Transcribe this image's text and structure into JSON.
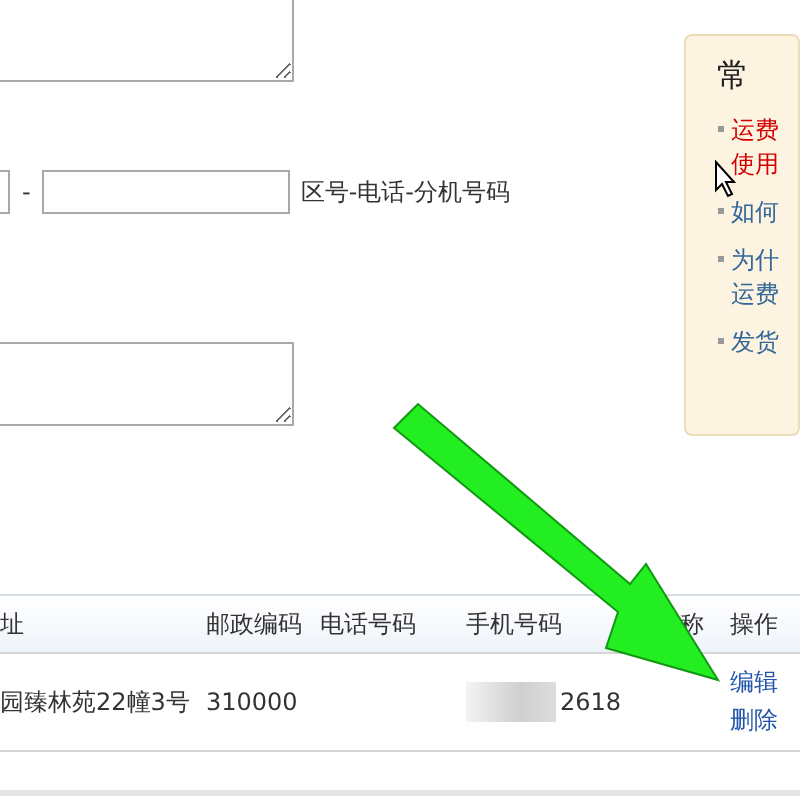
{
  "form": {
    "phone_separator": "-",
    "phone_hint": "区号-电话-分机号码"
  },
  "help_panel": {
    "title": "常",
    "items": [
      {
        "text": "运费使用",
        "kind": "highlight"
      },
      {
        "text": "如何",
        "kind": "normal"
      },
      {
        "text": "为什运费",
        "kind": "normal"
      },
      {
        "text": "发货",
        "kind": "normal"
      }
    ]
  },
  "table": {
    "columns": [
      "址",
      "邮政编码",
      "电话号码",
      "手机号码",
      "称",
      "操作"
    ],
    "rows": [
      {
        "address": "园臻林苑22幢3号",
        "postcode": "310000",
        "phone": "",
        "mobile": "2618",
        "actions": [
          "编辑",
          "删除"
        ]
      }
    ]
  }
}
